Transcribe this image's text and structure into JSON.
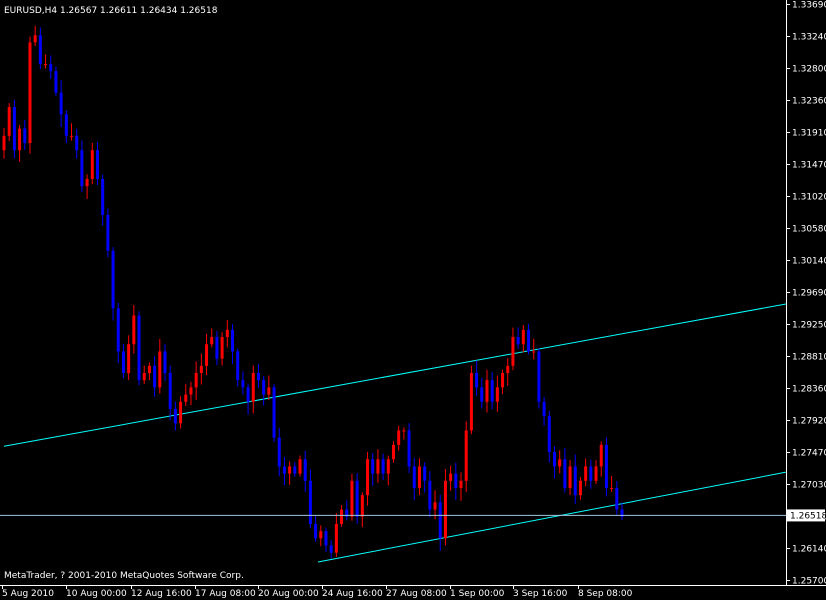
{
  "header": {
    "text": "EURUSD,H4  1.26567 1.26611 1.26434 1.26518"
  },
  "footer": {
    "copyright": "MetaTrader, ? 2001-2010 MetaQuotes Software Corp."
  },
  "colors": {
    "background": "#000000",
    "bull": "#ff0000",
    "bear": "#0000ff",
    "trendline": "#00ffff",
    "axis": "#ffffff",
    "price_label_bg": "#ffffff",
    "price_label_text": "#000000"
  },
  "chart_data": {
    "type": "candlestick",
    "symbol": "EURUSD",
    "timeframe": "H4",
    "current": {
      "open": 1.26567,
      "high": 1.26611,
      "low": 1.26434,
      "close": 1.26518
    },
    "current_price_label": "1.26518",
    "ylim": [
      1.2555,
      1.3369
    ],
    "y_ticks": [
      "1.33690",
      "1.33240",
      "1.32800",
      "1.32360",
      "1.31910",
      "1.31470",
      "1.31020",
      "1.30580",
      "1.30140",
      "1.29690",
      "1.29250",
      "1.28810",
      "1.28360",
      "1.27920",
      "1.27470",
      "1.27030",
      "1.26590",
      "1.26140",
      "1.25700"
    ],
    "x_ticks": [
      "5 Aug 2010",
      "10 Aug 00:00",
      "12 Aug 16:00",
      "17 Aug 08:00",
      "20 Aug 00:00",
      "24 Aug 16:00",
      "27 Aug 08:00",
      "1 Sep 00:00",
      "3 Sep 16:00",
      "8 Sep 08:00"
    ],
    "series": [
      {
        "name": "close",
        "values": [
          1.318,
          1.322,
          1.316,
          1.319,
          1.317,
          1.331,
          1.332,
          1.328,
          1.328,
          1.327,
          1.324,
          1.321,
          1.318,
          1.318,
          1.316,
          1.311,
          1.312,
          1.316,
          1.312,
          1.307,
          1.302,
          1.294,
          1.288,
          1.285,
          1.289,
          1.293,
          1.284,
          1.285,
          1.286,
          1.283,
          1.288,
          1.285,
          1.28,
          1.278,
          1.281,
          1.282,
          1.283,
          1.285,
          1.286,
          1.289,
          1.29,
          1.287,
          1.29,
          1.291,
          1.288,
          1.284,
          1.283,
          1.281,
          1.285,
          1.284,
          1.282,
          1.283,
          1.276,
          1.272,
          1.271,
          1.272,
          1.271,
          1.273,
          1.27,
          1.264,
          1.262,
          1.263,
          1.261,
          1.26,
          1.264,
          1.266,
          1.265,
          1.27,
          1.265,
          1.268,
          1.273,
          1.271,
          1.273,
          1.271,
          1.273,
          1.275,
          1.277,
          1.277,
          1.272,
          1.269,
          1.272,
          1.27,
          1.266,
          1.267,
          1.262,
          1.27,
          1.271,
          1.269,
          1.27,
          1.277,
          1.285,
          1.283,
          1.281,
          1.284,
          1.281,
          1.283,
          1.285,
          1.286,
          1.29,
          1.289,
          1.291,
          1.288,
          1.288,
          1.281,
          1.279,
          1.274,
          1.272,
          1.273,
          1.269,
          1.272,
          1.268,
          1.27,
          1.272,
          1.27,
          1.272,
          1.275,
          1.269,
          1.269,
          1.266,
          1.265
        ]
      }
    ]
  }
}
